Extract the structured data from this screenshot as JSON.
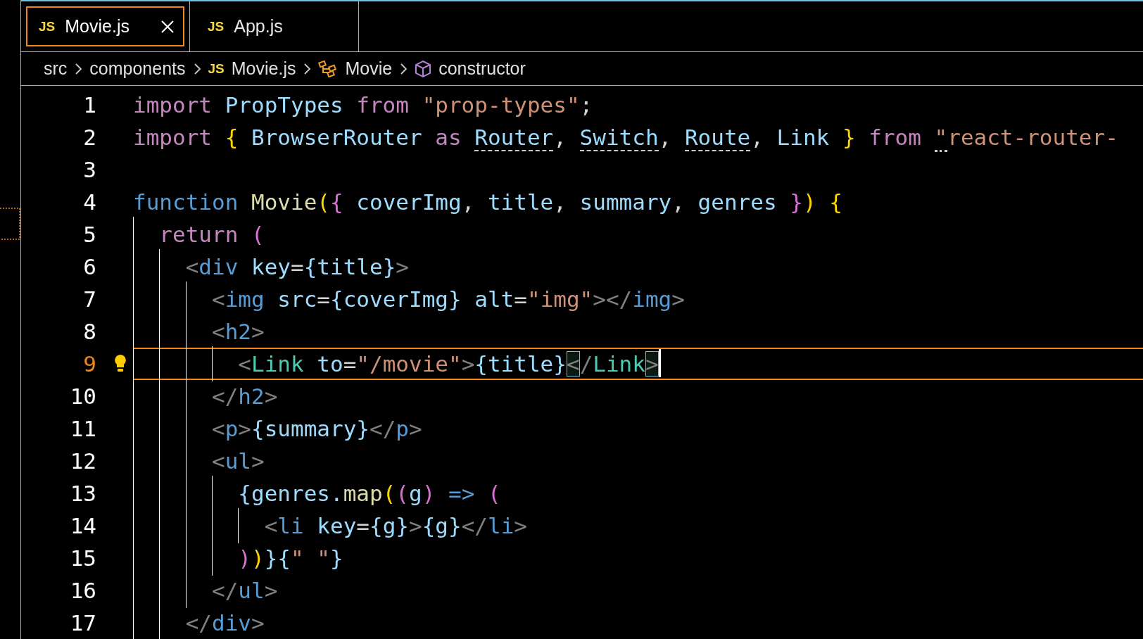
{
  "tabs": [
    {
      "label": "Movie.js",
      "icon": "JS",
      "selected": true,
      "closable": true
    },
    {
      "label": "App.js",
      "icon": "JS",
      "selected": false,
      "closable": false
    }
  ],
  "breadcrumb": [
    {
      "kind": "folder",
      "label": "src"
    },
    {
      "kind": "folder",
      "label": "components"
    },
    {
      "kind": "file",
      "icon": "JS",
      "label": "Movie.js"
    },
    {
      "kind": "function",
      "label": "Movie"
    },
    {
      "kind": "method",
      "label": "constructor"
    }
  ],
  "lines": [
    {
      "number": "1",
      "current": false,
      "tokens": [
        {
          "kind": "kw",
          "text": "import "
        },
        {
          "kind": "var",
          "text": "PropTypes "
        },
        {
          "kind": "kw",
          "text": "from "
        },
        {
          "kind": "str",
          "text": "\"prop-types\""
        },
        {
          "kind": "plain",
          "text": ";"
        }
      ]
    },
    {
      "number": "2",
      "current": false,
      "tokens": [
        {
          "kind": "kw",
          "text": "import "
        },
        {
          "kind": "y",
          "text": "{ "
        },
        {
          "kind": "var",
          "text": "BrowserRouter "
        },
        {
          "kind": "kw",
          "text": "as "
        },
        {
          "kind": "var",
          "text": "Router",
          "unused": true
        },
        {
          "kind": "plain",
          "text": ", "
        },
        {
          "kind": "var",
          "text": "Switch",
          "unused": true
        },
        {
          "kind": "plain",
          "text": ", "
        },
        {
          "kind": "var",
          "text": "Route",
          "unused": true
        },
        {
          "kind": "plain",
          "text": ", "
        },
        {
          "kind": "var",
          "text": "Link "
        },
        {
          "kind": "y",
          "text": "} "
        },
        {
          "kind": "kw",
          "text": "from "
        },
        {
          "kind": "str",
          "text": "\"",
          "info": true
        },
        {
          "kind": "str",
          "text": "react-router-"
        }
      ]
    },
    {
      "number": "3",
      "current": false
    },
    {
      "number": "4",
      "current": false,
      "tokens": [
        {
          "kind": "decl",
          "text": "function "
        },
        {
          "kind": "fn",
          "text": "Movie"
        },
        {
          "kind": "y",
          "text": "("
        },
        {
          "kind": "p",
          "text": "{ "
        },
        {
          "kind": "var",
          "text": "coverImg"
        },
        {
          "kind": "plain",
          "text": ", "
        },
        {
          "kind": "var",
          "text": "title"
        },
        {
          "kind": "plain",
          "text": ", "
        },
        {
          "kind": "var",
          "text": "summary"
        },
        {
          "kind": "plain",
          "text": ", "
        },
        {
          "kind": "var",
          "text": "genres "
        },
        {
          "kind": "p",
          "text": "}"
        },
        {
          "kind": "y",
          "text": ") {"
        }
      ]
    },
    {
      "number": "5",
      "current": false,
      "tokens": [
        {
          "kind": "kw",
          "text": "  return "
        },
        {
          "kind": "p",
          "text": "("
        }
      ]
    },
    {
      "number": "6",
      "current": false,
      "tokens": [
        {
          "kind": "ang",
          "text": "    <"
        },
        {
          "kind": "tag",
          "text": "div "
        },
        {
          "kind": "var",
          "text": "key"
        },
        {
          "kind": "plain",
          "text": "="
        },
        {
          "kind": "var",
          "text": "{title}"
        },
        {
          "kind": "ang",
          "text": ">"
        }
      ]
    },
    {
      "number": "7",
      "current": false,
      "tokens": [
        {
          "kind": "ang",
          "text": "      <"
        },
        {
          "kind": "tag",
          "text": "img "
        },
        {
          "kind": "var",
          "text": "src"
        },
        {
          "kind": "plain",
          "text": "="
        },
        {
          "kind": "var",
          "text": "{coverImg} "
        },
        {
          "kind": "var",
          "text": "alt"
        },
        {
          "kind": "plain",
          "text": "="
        },
        {
          "kind": "str",
          "text": "\"img\""
        },
        {
          "kind": "ang",
          "text": "></"
        },
        {
          "kind": "tag",
          "text": "img"
        },
        {
          "kind": "ang",
          "text": ">"
        }
      ]
    },
    {
      "number": "8",
      "current": false,
      "tokens": [
        {
          "kind": "ang",
          "text": "      <"
        },
        {
          "kind": "tag",
          "text": "h2"
        },
        {
          "kind": "ang",
          "text": ">"
        }
      ]
    },
    {
      "number": "9",
      "current": true,
      "tokens": [
        {
          "kind": "ang",
          "text": "        <"
        },
        {
          "kind": "comp",
          "text": "Link "
        },
        {
          "kind": "var",
          "text": "to"
        },
        {
          "kind": "plain",
          "text": "="
        },
        {
          "kind": "str",
          "text": "\"/movie\""
        },
        {
          "kind": "ang",
          "text": ">"
        },
        {
          "kind": "var",
          "text": "{title}"
        },
        {
          "kind": "ang",
          "text": "<",
          "matched": true
        },
        {
          "kind": "ang",
          "text": "/"
        },
        {
          "kind": "comp",
          "text": "Link"
        },
        {
          "kind": "ang",
          "text": ">",
          "matched": true
        }
      ]
    },
    {
      "number": "10",
      "current": false,
      "tokens": [
        {
          "kind": "ang",
          "text": "      </"
        },
        {
          "kind": "tag",
          "text": "h2"
        },
        {
          "kind": "ang",
          "text": ">"
        }
      ]
    },
    {
      "number": "11",
      "current": false,
      "tokens": [
        {
          "kind": "ang",
          "text": "      <"
        },
        {
          "kind": "tag",
          "text": "p"
        },
        {
          "kind": "ang",
          "text": ">"
        },
        {
          "kind": "var",
          "text": "{summary}"
        },
        {
          "kind": "ang",
          "text": "</"
        },
        {
          "kind": "tag",
          "text": "p"
        },
        {
          "kind": "ang",
          "text": ">"
        }
      ]
    },
    {
      "number": "12",
      "current": false,
      "tokens": [
        {
          "kind": "ang",
          "text": "      <"
        },
        {
          "kind": "tag",
          "text": "ul"
        },
        {
          "kind": "ang",
          "text": ">"
        }
      ]
    },
    {
      "number": "13",
      "current": false,
      "tokens": [
        {
          "kind": "var",
          "text": "        {genres."
        },
        {
          "kind": "fn",
          "text": "map"
        },
        {
          "kind": "y",
          "text": "("
        },
        {
          "kind": "p",
          "text": "("
        },
        {
          "kind": "var",
          "text": "g"
        },
        {
          "kind": "p",
          "text": ") "
        },
        {
          "kind": "decl",
          "text": "=> "
        },
        {
          "kind": "p",
          "text": "("
        }
      ]
    },
    {
      "number": "14",
      "current": false,
      "tokens": [
        {
          "kind": "ang",
          "text": "          <"
        },
        {
          "kind": "tag",
          "text": "li "
        },
        {
          "kind": "var",
          "text": "key"
        },
        {
          "kind": "plain",
          "text": "="
        },
        {
          "kind": "var",
          "text": "{g}"
        },
        {
          "kind": "ang",
          "text": ">"
        },
        {
          "kind": "var",
          "text": "{g}"
        },
        {
          "kind": "ang",
          "text": "</"
        },
        {
          "kind": "tag",
          "text": "li"
        },
        {
          "kind": "ang",
          "text": ">"
        }
      ]
    },
    {
      "number": "15",
      "current": false,
      "tokens": [
        {
          "kind": "p",
          "text": "        )"
        },
        {
          "kind": "y",
          "text": ")"
        },
        {
          "kind": "var",
          "text": "}{"
        },
        {
          "kind": "str",
          "text": "\" \""
        },
        {
          "kind": "var",
          "text": "}"
        }
      ]
    },
    {
      "number": "16",
      "current": false,
      "tokens": [
        {
          "kind": "ang",
          "text": "      </"
        },
        {
          "kind": "tag",
          "text": "ul"
        },
        {
          "kind": "ang",
          "text": ">"
        }
      ]
    },
    {
      "number": "17",
      "current": false,
      "tokens": [
        {
          "kind": "ang",
          "text": "    </"
        },
        {
          "kind": "tag",
          "text": "div"
        },
        {
          "kind": "ang",
          "text": ">"
        }
      ]
    }
  ]
}
